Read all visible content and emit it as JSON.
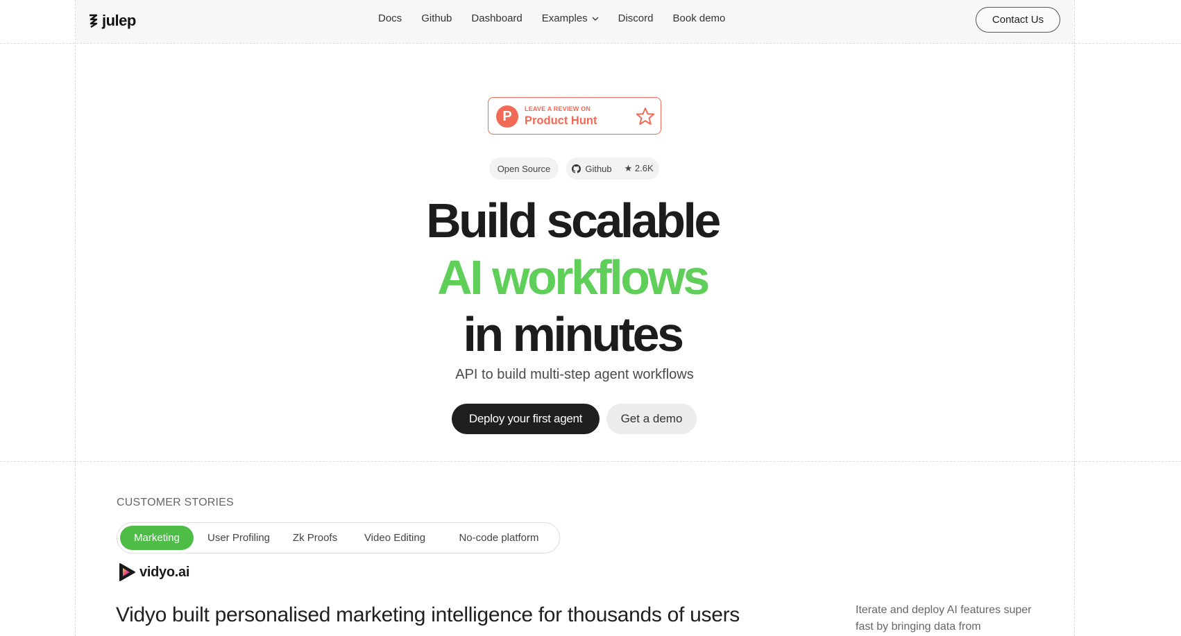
{
  "header": {
    "logo_text": "julep",
    "nav": [
      "Docs",
      "Github",
      "Dashboard",
      "Examples",
      "Discord",
      "Book demo"
    ],
    "contact_label": "Contact Us"
  },
  "badge": {
    "small_text": "LEAVE A REVIEW ON",
    "big_text": "Product Hunt",
    "letter": "P"
  },
  "pills": {
    "open_source": "Open Source",
    "github_label": "Github",
    "stars": "★ 2.6K"
  },
  "hero": {
    "line1": "Build scalable",
    "line2": "AI workflows",
    "line3": "in minutes",
    "subtitle": "API to build multi-step agent workflows",
    "primary_cta": "Deploy your first agent",
    "secondary_cta": "Get a demo"
  },
  "stories": {
    "label": "CUSTOMER STORIES",
    "tabs": [
      "Marketing",
      "User Profiling",
      "Zk Proofs",
      "Video Editing",
      "No-code platform"
    ],
    "active_tab": "Marketing",
    "company_logo_text": "vidyo.ai",
    "title": "Vidyo built personalised marketing intelligence for thousands of users",
    "side_text": "Iterate and deploy AI features super fast by bringing data from"
  },
  "colors": {
    "accent_green": "#5fcf5a",
    "tab_green": "#4dbd48",
    "product_hunt": "#f06a55",
    "dark": "#1f1f1f"
  },
  "icons": {
    "logo": "julep-logo-icon",
    "chevron": "chevron-down-icon",
    "star": "star-outline-icon",
    "github": "github-icon"
  }
}
